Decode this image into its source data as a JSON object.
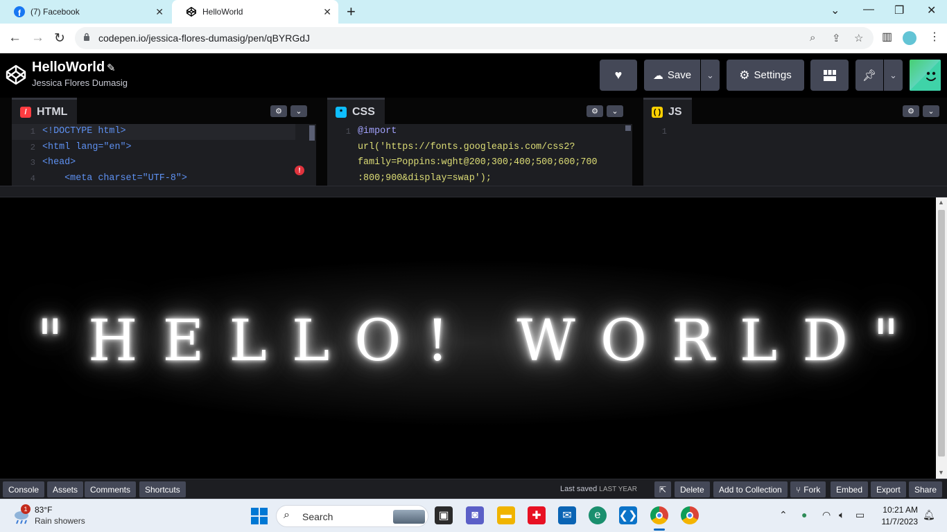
{
  "browser": {
    "tabs": [
      {
        "title": "(7) Facebook",
        "icon": "facebook-icon"
      },
      {
        "title": "HelloWorld",
        "icon": "codepen-icon"
      }
    ],
    "url": "codepen.io/jessica-flores-dumasig/pen/qBYRGdJ"
  },
  "header": {
    "pen_title": "HelloWorld",
    "author": "Jessica Flores Dumasig",
    "save_label": "Save",
    "settings_label": "Settings"
  },
  "editors": {
    "html": {
      "label": "HTML",
      "accent": "#ff3c41",
      "lines": [
        {
          "num": "1",
          "text": "<!DOCTYPE html>"
        },
        {
          "num": "2",
          "text": "<html lang=\"en\">"
        },
        {
          "num": "3",
          "text": "<head>"
        },
        {
          "num": "4",
          "text": "    <meta charset=\"UTF-8\">"
        }
      ]
    },
    "css": {
      "label": "CSS",
      "accent": "#0ebeff",
      "lines": [
        {
          "num": "1",
          "text": "@import"
        },
        {
          "num": "",
          "text": "url('https://fonts.googleapis.com/css2?"
        },
        {
          "num": "",
          "text": "family=Poppins:wght@200;300;400;500;600;700"
        },
        {
          "num": "",
          "text": ":800;900&display=swap');"
        }
      ]
    },
    "js": {
      "label": "JS",
      "accent": "#fcd000",
      "lines": [
        {
          "num": "1",
          "text": ""
        }
      ]
    }
  },
  "preview": {
    "text": "\"HELLO! WORLD\""
  },
  "footer": {
    "left_buttons": [
      "Console",
      "Assets",
      "Comments",
      "Shortcuts"
    ],
    "last_saved_prefix": "Last saved",
    "last_saved_when": "LAST YEAR",
    "right_buttons": [
      "Delete",
      "Add to Collection",
      "Fork",
      "Embed",
      "Export",
      "Share"
    ]
  },
  "taskbar": {
    "weather_badge": "1",
    "temperature": "83°F",
    "condition": "Rain showers",
    "search_label": "Search",
    "time": "10:21 AM",
    "date": "11/7/2023"
  }
}
